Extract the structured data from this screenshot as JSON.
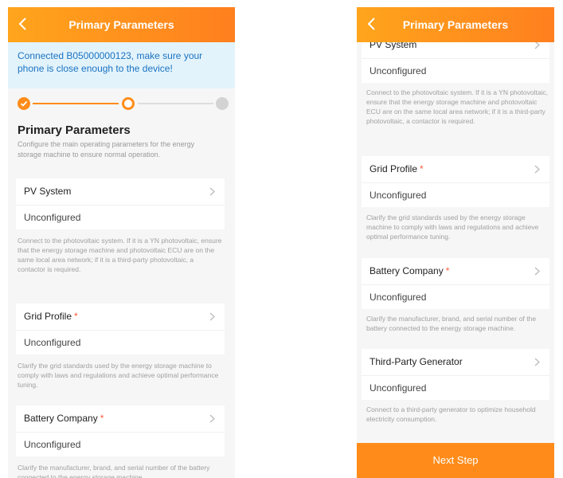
{
  "header": {
    "title": "Primary Parameters"
  },
  "banner": {
    "text": "Connected B05000000123, make sure your phone is close enough to the device!"
  },
  "section": {
    "title": "Primary Parameters",
    "description": "Configure the main operating parameters for the energy storage machine to ensure normal operation."
  },
  "params": [
    {
      "label": "PV System",
      "required": false,
      "value": "Unconfigured",
      "help": "Connect to the photovoltaic system. If it is a YN photovoltaic, ensure that the energy storage machine and photovoltaic ECU are on the same local area network; if it is a third-party photovoltaic, a contactor is required."
    },
    {
      "label": "Grid Profile",
      "required": true,
      "value": "Unconfigured",
      "help": "Clarify the grid standards used by the energy storage machine to comply with laws and regulations and achieve optimal performance tuning."
    },
    {
      "label": "Battery Company",
      "required": true,
      "value": "Unconfigured",
      "help": "Clarify the manufacturer, brand, and serial number of the battery connected to the energy storage machine."
    },
    {
      "label": "Third-Party Generator",
      "required": false,
      "value": "Unconfigured",
      "help": "Connect to a third-party generator to optimize household electricity consumption."
    }
  ],
  "required_marker": "*",
  "next_button": {
    "label": "Next Step"
  },
  "colors": {
    "accent": "#ff8c1a",
    "banner_bg": "#e3f3fb",
    "banner_text": "#1a73c2"
  }
}
